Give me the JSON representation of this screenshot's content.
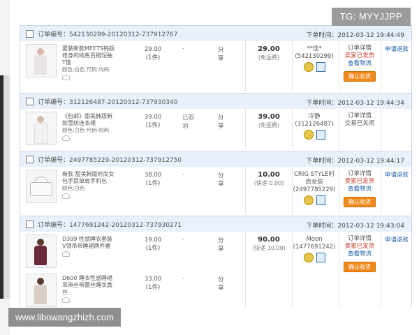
{
  "watermark_top": "TG: MYYJJPP",
  "watermark_bottom": "www.libowangzhizh.com",
  "orders": [
    {
      "order_label": "订单编号：542130299-20120312-737912767",
      "order_time": "下单时间：2012-03-12 19:44:49",
      "items": [
        {
          "title": "夏装新款MEETS韩版修身的纯色百搭短袖T恤",
          "attr": "颜色:白色 尺码:均码",
          "price": "29.00",
          "qty": "(1件)",
          "item_status": "-",
          "share": "分享"
        }
      ],
      "total": "29.00",
      "shipping": "(免运费)",
      "seller_name": "**佳*",
      "seller_id": "(542130299)",
      "status": [
        "订单详情",
        "卖家已发货",
        "查看物流"
      ],
      "confirm_button": "确认收货",
      "refund": "申请退款"
    },
    {
      "order_label": "订单编号：312126487-20120312-737930340",
      "order_time": "下单时间：2012-03-12 19:44:34",
      "items": [
        {
          "title": "《包邮》甜美韩版新款雪纺连衣裙",
          "attr": "颜色:白色 尺码:均码",
          "price": "39.00",
          "qty": "(1件)",
          "item_status": "已取消",
          "share": "分享"
        }
      ],
      "total": "39.00",
      "shipping": "(免运费)",
      "seller_name": "冷静",
      "seller_id": "(312126487)",
      "status": [
        "订单详情",
        "交易已关闭"
      ],
      "confirm_button": "",
      "refund": ""
    },
    {
      "order_label": "订单编号：2497785229-20120312-737912750",
      "order_time": "下单时间：2012-03-12 19:44:17",
      "items": [
        {
          "title": "新款 甜美韩版时尚女包手提单肩手机包",
          "attr": "颜色:白色",
          "price": "38.00",
          "qty": "(1件)",
          "item_status": "-",
          "share": "分享"
        }
      ],
      "total": "10.00",
      "shipping": "(快递 0.00)",
      "seller_name": "CRIG STYLE时尚女装",
      "seller_id": "(2497785229)",
      "status": [
        "订单详情",
        "卖家已发货",
        "查看物流"
      ],
      "confirm_button": "确认收货",
      "refund": "申请退款"
    },
    {
      "order_label": "订单编号：1477691242-20120312-737930271",
      "order_time": "下单时间：2012-03-12 19:43:04",
      "items": [
        {
          "title": "D399 性感睡衣套装V领吊带睡裙两件套",
          "attr": "",
          "price": "19.00",
          "qty": "(1件)",
          "item_status": "-",
          "share": "分享"
        },
        {
          "title": "D600 睡衣性感睡裙吊带丝带蕾丝睡衣真丝",
          "attr": "",
          "price": "33.00",
          "qty": "(1件)",
          "item_status": "-",
          "share": "分享"
        }
      ],
      "total": "90.00",
      "shipping": "(快递 10.00)",
      "seller_name": "Moon",
      "seller_id": "(1477691242)",
      "status": [
        "订单详情",
        "卖家已发货",
        "查看物流"
      ],
      "confirm_button": "确认收货",
      "refund": "申请退款"
    }
  ]
}
